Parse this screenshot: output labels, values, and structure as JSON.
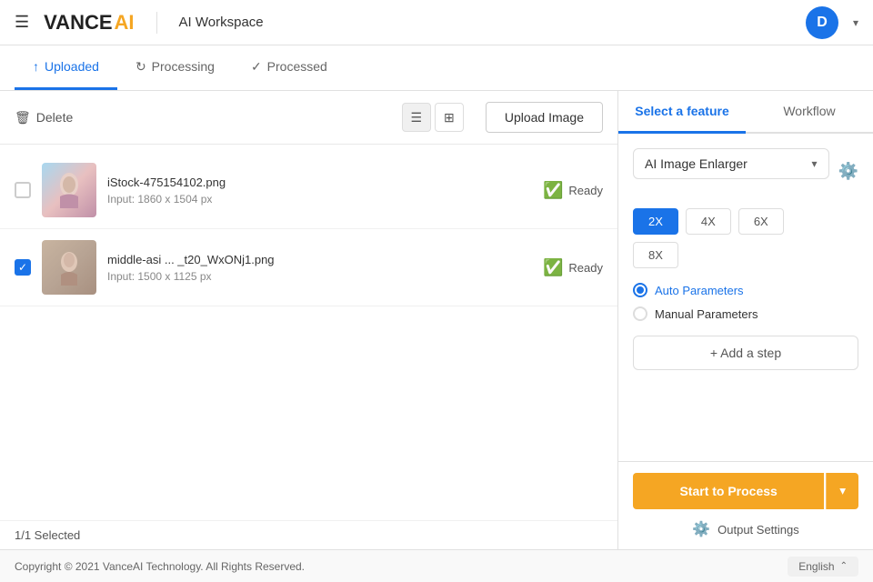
{
  "header": {
    "hamburger_label": "☰",
    "logo_vance": "VANCE",
    "logo_ai": "AI",
    "workspace_title": "AI Workspace",
    "avatar_letter": "D",
    "caret": "▾"
  },
  "tabs": [
    {
      "id": "uploaded",
      "label": "Uploaded",
      "icon": "↑",
      "active": true
    },
    {
      "id": "processing",
      "label": "Processing",
      "icon": "↻",
      "active": false
    },
    {
      "id": "processed",
      "label": "Processed",
      "icon": "✓",
      "active": false
    }
  ],
  "toolbar": {
    "delete_label": "Delete",
    "delete_icon": "🗑",
    "upload_label": "Upload Image"
  },
  "files": [
    {
      "id": "file1",
      "name": "iStock-475154102.png",
      "dimensions": "Input: 1860 x 1504 px",
      "status": "Ready",
      "checked": false,
      "thumb_color_start": "#a8d8ea",
      "thumb_color_end": "#c4a0b0"
    },
    {
      "id": "file2",
      "name": "middle-asi ... _t20_WxONj1.png",
      "dimensions": "Input: 1500 x 1125 px",
      "status": "Ready",
      "checked": true,
      "thumb_color_start": "#c8b4a0",
      "thumb_color_end": "#a89888"
    }
  ],
  "right_panel": {
    "tabs": [
      {
        "id": "select-feature",
        "label": "Select a feature",
        "active": true
      },
      {
        "id": "workflow",
        "label": "Workflow",
        "active": false
      }
    ],
    "dropdown_label": "AI Image Enlarger",
    "scale_options": [
      {
        "label": "2X",
        "active": true
      },
      {
        "label": "4X",
        "active": false
      },
      {
        "label": "6X",
        "active": false
      },
      {
        "label": "8X",
        "active": false
      }
    ],
    "parameters": [
      {
        "id": "auto",
        "label": "Auto Parameters",
        "checked": true
      },
      {
        "id": "manual",
        "label": "Manual Parameters",
        "checked": false
      }
    ],
    "add_step_label": "+ Add a step",
    "process_btn_label": "Start to Process",
    "output_settings_label": "Output Settings"
  },
  "footer": {
    "copyright": "Copyright © 2021 VanceAI Technology. All Rights Reserved.",
    "language": "English",
    "lang_icon": "⚙",
    "chevron": "⌃"
  },
  "selected_info": "1/1 Selected"
}
